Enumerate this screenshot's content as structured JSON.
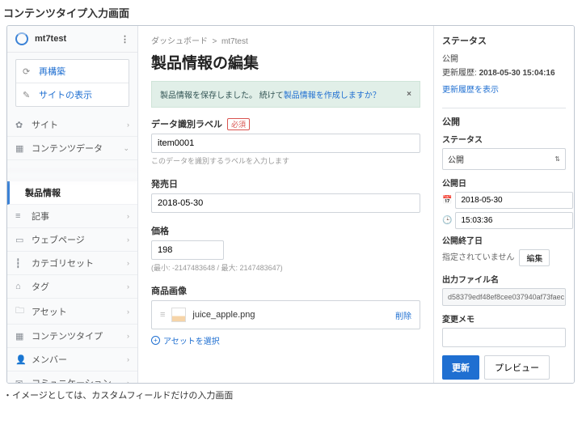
{
  "page_heading": "コンテンツタイプ入力画面",
  "caption": "・イメージとしては、カスタムフィールドだけの入力画面",
  "sidebar": {
    "site_name": "mt7test",
    "rebuild": "再構築",
    "view_site": "サイトの表示",
    "sections": {
      "site": "サイト",
      "content_data": "コンテンツデータ",
      "active_sub": "製品情報",
      "entries": "記事",
      "webpages": "ウェブページ",
      "category_set": "カテゴリセット",
      "tag": "タグ",
      "assets": "アセット",
      "content_types": "コンテンツタイプ",
      "members": "メンバー",
      "communication": "コミュニケーション"
    },
    "user": "mt7test"
  },
  "main": {
    "crumb_a": "ダッシュボード",
    "crumb_b": "mt7test",
    "title": "製品情報の編集",
    "alert_text": "製品情報を保存しました。 続けて",
    "alert_link": "製品情報を作成しますか？",
    "fields": {
      "label": {
        "label": "データ識別ラベル",
        "required": "必須",
        "value": "item0001",
        "hint": "このデータを識別するラベルを入力します"
      },
      "release": {
        "label": "発売日",
        "value": "2018-05-30"
      },
      "price": {
        "label": "価格",
        "value": "198",
        "hint": "(最小: -2147483648 / 最大: 2147483647)"
      },
      "image": {
        "label": "商品画像",
        "filename": "juice_apple.png",
        "delete": "削除",
        "select": "アセットを選択"
      }
    }
  },
  "right": {
    "status_h": "ステータス",
    "pub": "公開",
    "history": "更新履歴: ",
    "history_ts": "2018-05-30 15:04:16",
    "show_history": "更新履歴を表示",
    "publish_h": "公開",
    "status_lbl": "ステータス",
    "status_val": "公開",
    "pub_date_lbl": "公開日",
    "pub_date": "2018-05-30",
    "pub_time": "15:03:36",
    "end_lbl": "公開終了日",
    "end_none": "指定されていません",
    "edit": "編集",
    "outfile_lbl": "出力ファイル名",
    "outfile": "d58379edf48ef8cee037940af73faec",
    "memo_lbl": "変更メモ",
    "update": "更新",
    "preview": "プレビュー"
  }
}
